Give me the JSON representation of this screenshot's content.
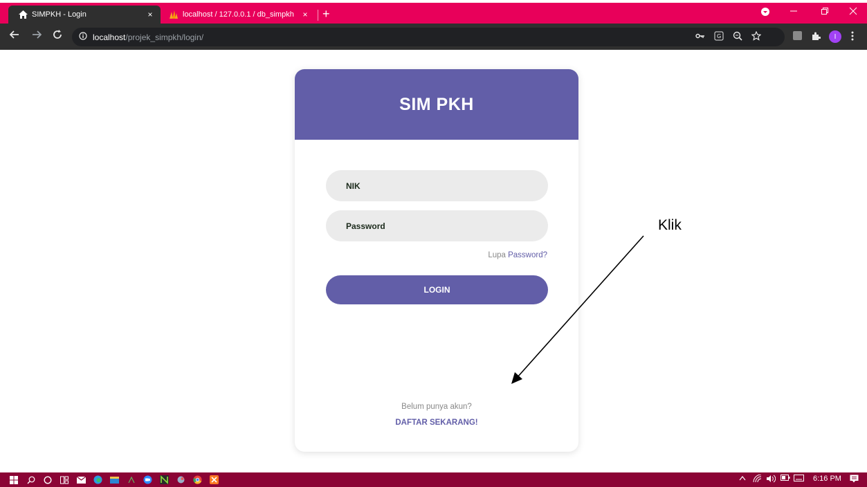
{
  "browser": {
    "tabs": [
      {
        "title": "SIMPKH - Login",
        "close": "×"
      },
      {
        "title": "localhost / 127.0.0.1 / db_simpkh",
        "close": "×"
      }
    ],
    "new_tab": "+",
    "url_host": "localhost",
    "url_path": "/projek_simpkh/login/",
    "profile_initial": "I",
    "tab_colors": {
      "tabbar": "#e8005a",
      "active_tab": "#2f2f2f"
    }
  },
  "login": {
    "app_title": "SIM PKH",
    "nik_placeholder": "NIK",
    "password_placeholder": "Password",
    "forgot_prefix": "Lupa",
    "forgot_link": "Password?",
    "login_button": "LOGIN",
    "no_account": "Belum punya akun?",
    "register_link": "DAFTAR SEKARANG!",
    "accent_color": "#625ea8"
  },
  "annotation": {
    "label": "Klik"
  },
  "taskbar": {
    "time": "6:16 PM",
    "color": "#8b0435"
  }
}
